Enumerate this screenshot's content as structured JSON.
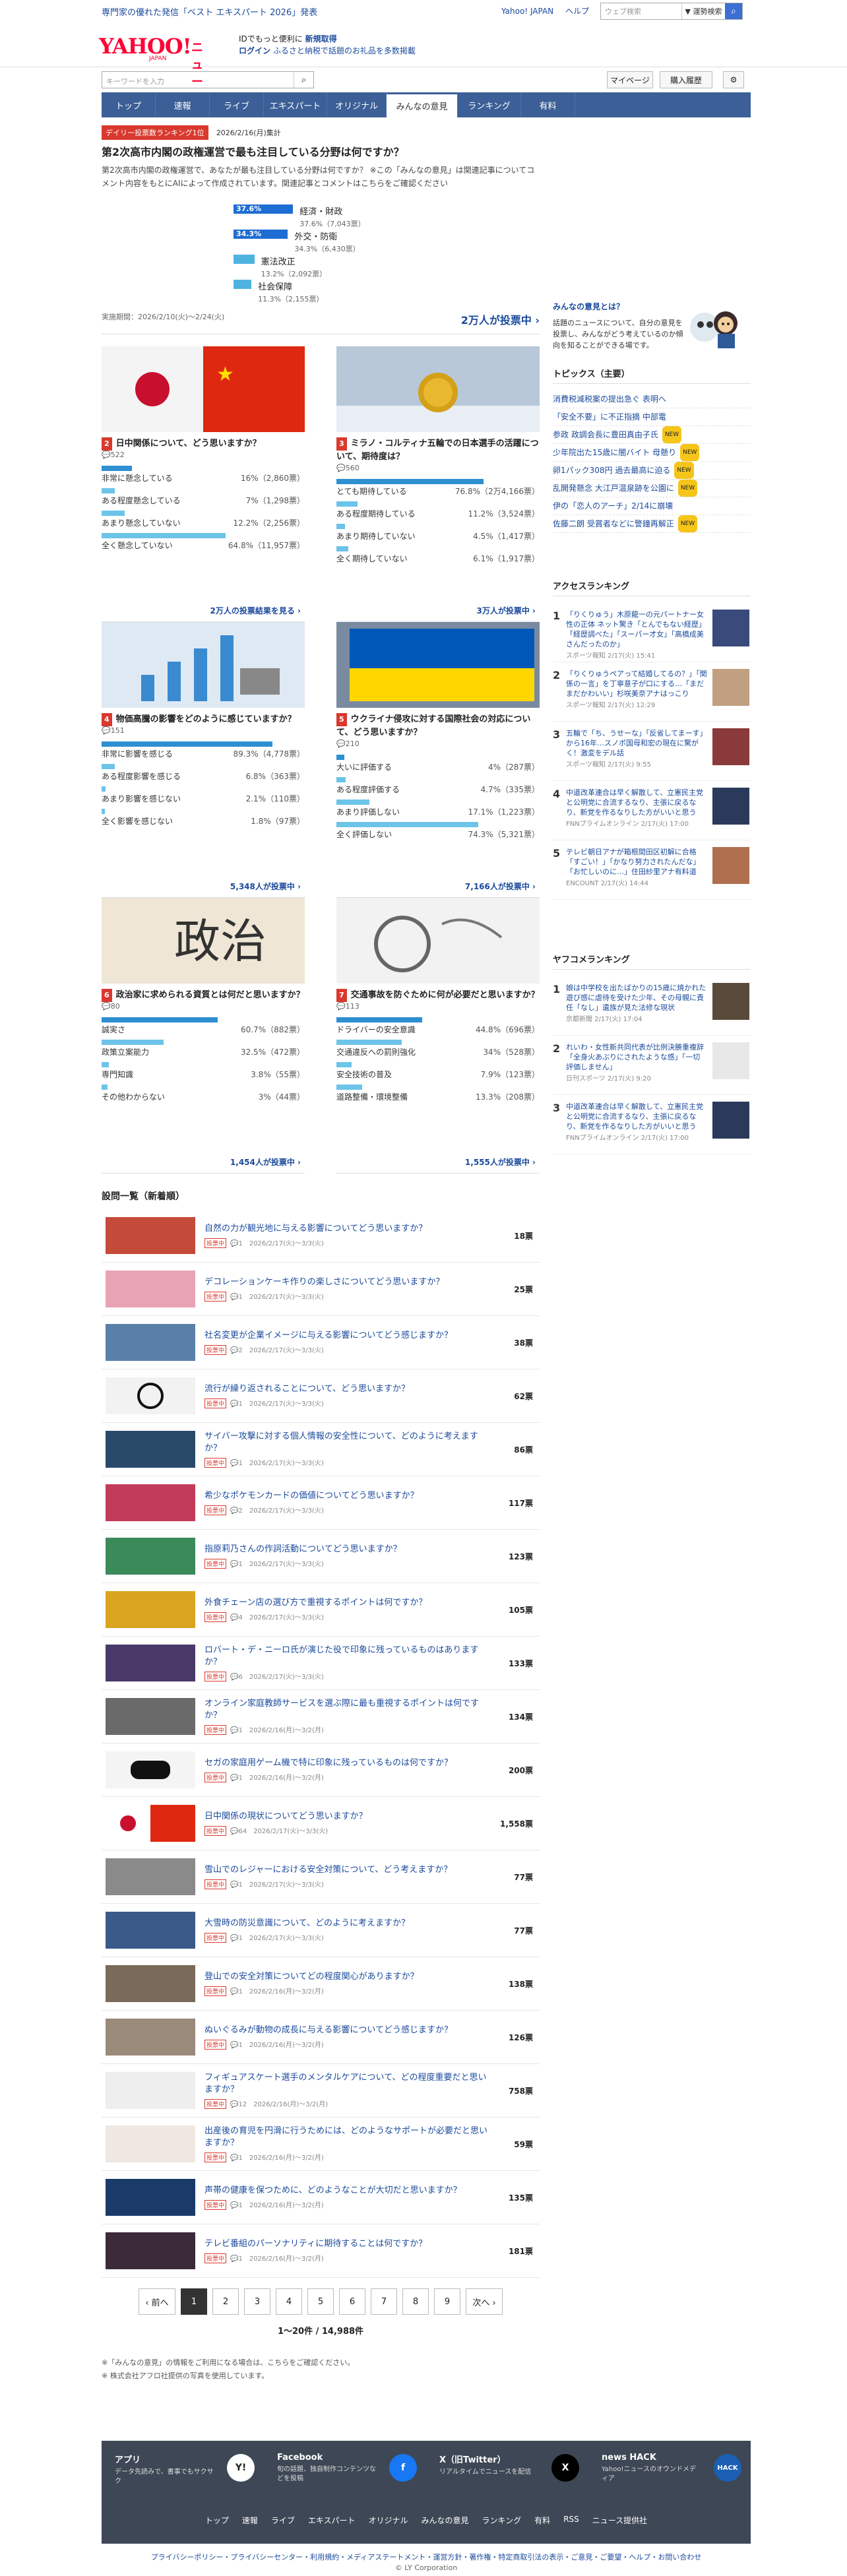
{
  "topbar": {
    "promo": "専門家の優れた発信「ベスト エキスパート 2026」発表",
    "links": [
      "Yahoo! JAPAN",
      "ヘルプ"
    ],
    "search_placeholder": "ウェブ検索",
    "search_option": "▼ 運勢検索"
  },
  "header": {
    "logo": "YAHOO!",
    "logo_sub": "JAPAN",
    "service": "ニュース",
    "msg1": "IDでもっと便利に",
    "msg1_link": "新規取得",
    "msg2_link": "ログイン",
    "msg2": "ふるさと納税で話題のお礼品を多数掲載"
  },
  "search2": {
    "placeholder": "キーワードを入力"
  },
  "rightbtns": [
    "マイページ",
    "購入履歴"
  ],
  "gnav": [
    "トップ",
    "速報",
    "ライブ",
    "エキスパート",
    "オリジナル",
    "みんなの意見",
    "ランキング",
    "有料"
  ],
  "hero": {
    "badge": "デイリー投票数ランキング1位",
    "date": "2026/2/16(月)集計",
    "title": "第2次高市内閣の政権運営で最も注目している分野は何ですか？",
    "desc": "第2次高市内閣の政権運営で、あなたが最も注目している分野は何ですか？ ※この「みんなの意見」は関連記事についてコメント内容をもとにAIによって作成されています。関連記事とコメントはこちらをご確認ください",
    "options": [
      {
        "label": "経済・財政",
        "pct": "37.6%",
        "sub": "37.6%（7,043票）",
        "v": 37.6
      },
      {
        "label": "外交・防衛",
        "pct": "34.3%",
        "sub": "34.3%（6,430票）",
        "v": 34.3
      },
      {
        "label": "憲法改正",
        "pct": "",
        "sub": "13.2%（2,092票）",
        "v": 13.2
      },
      {
        "label": "社会保障",
        "pct": "",
        "sub": "11.3%（2,155票）",
        "v": 11.3
      }
    ],
    "period": "実施期間：2026/2/10(火)〜2/24(火)",
    "total": "2万人が投票中 ›"
  },
  "cards": [
    {
      "no": "2",
      "q": "日中関係について、どう思いますか？",
      "meta": "💬522",
      "rows": [
        {
          "l": "非常に懸念している",
          "p": "16%（2,860票）",
          "v": 16
        },
        {
          "l": "ある程度懸念している",
          "p": "7%（1,298票）",
          "v": 7
        },
        {
          "l": "あまり懸念していない",
          "p": "12.2%（2,256票）",
          "v": 12.2
        },
        {
          "l": "全く懸念していない",
          "p": "64.8%（11,957票）",
          "v": 64.8
        }
      ],
      "tot": "2万人の投票結果を見る ›"
    },
    {
      "no": "3",
      "q": "ミラノ・コルティナ五輪での日本選手の活躍について、期待度は？",
      "meta": "💬560",
      "rows": [
        {
          "l": "とても期待している",
          "p": "76.8%（2万4,166票）",
          "v": 76.8
        },
        {
          "l": "ある程度期待している",
          "p": "11.2%（3,524票）",
          "v": 11.2
        },
        {
          "l": "あまり期待していない",
          "p": "4.5%（1,417票）",
          "v": 4.5
        },
        {
          "l": "全く期待していない",
          "p": "6.1%（1,917票）",
          "v": 6.1
        }
      ],
      "tot": "3万人が投票中 ›"
    },
    {
      "no": "4",
      "q": "物価高騰の影響をどのように感じていますか？",
      "meta": "💬151",
      "rows": [
        {
          "l": "非常に影響を感じる",
          "p": "89.3%（4,778票）",
          "v": 89.3
        },
        {
          "l": "ある程度影響を感じる",
          "p": "6.8%（363票）",
          "v": 6.8
        },
        {
          "l": "あまり影響を感じない",
          "p": "2.1%（110票）",
          "v": 2.1
        },
        {
          "l": "全く影響を感じない",
          "p": "1.8%（97票）",
          "v": 1.8
        }
      ],
      "tot": "5,348人が投票中 ›"
    },
    {
      "no": "5",
      "q": "ウクライナ侵攻に対する国際社会の対応について、どう思いますか？",
      "meta": "💬210",
      "rows": [
        {
          "l": "大いに評価する",
          "p": "4%（287票）",
          "v": 4
        },
        {
          "l": "ある程度評価する",
          "p": "4.7%（335票）",
          "v": 4.7
        },
        {
          "l": "あまり評価しない",
          "p": "17.1%（1,223票）",
          "v": 17.1
        },
        {
          "l": "全く評価しない",
          "p": "74.3%（5,321票）",
          "v": 74.3
        }
      ],
      "tot": "7,166人が投票中 ›"
    },
    {
      "no": "6",
      "q": "政治家に求められる資質とは何だと思いますか？",
      "meta": "💬80",
      "rows": [
        {
          "l": "誠実さ",
          "p": "60.7%（882票）",
          "v": 60.7
        },
        {
          "l": "政策立案能力",
          "p": "32.5%（472票）",
          "v": 32.5
        },
        {
          "l": "専門知識",
          "p": "3.8%（55票）",
          "v": 3.8
        },
        {
          "l": "その他わからない",
          "p": "3%（44票）",
          "v": 3
        }
      ],
      "tot": "1,454人が投票中 ›"
    },
    {
      "no": "7",
      "q": "交通事故を防ぐために何が必要だと思いますか？",
      "meta": "💬113",
      "rows": [
        {
          "l": "ドライバーの安全意識",
          "p": "44.8%（696票）",
          "v": 44.8
        },
        {
          "l": "交通違反への罰則強化",
          "p": "34%（528票）",
          "v": 34
        },
        {
          "l": "安全技術の普及",
          "p": "7.9%（123票）",
          "v": 7.9
        },
        {
          "l": "道路整備・環境整備",
          "p": "13.3%（208票）",
          "v": 13.3
        }
      ],
      "tot": "1,555人が投票中 ›"
    }
  ],
  "list_title": "設問一覧（新着順）",
  "list": [
    {
      "t": "自然の力が観光地に与える影響についてどう思いますか？",
      "m": "💬1　2026/2/17(火)〜3/3(火)",
      "v": "18票",
      "c": "#c44a3a"
    },
    {
      "t": "デコレーションケーキ作りの楽しさについてどう思いますか？",
      "m": "💬1　2026/2/17(火)〜3/3(火)",
      "v": "25票",
      "c": "#e8a3b5"
    },
    {
      "t": "社名変更が企業イメージに与える影響についてどう感じますか？",
      "m": "💬2　2026/2/17(火)〜3/3(火)",
      "v": "38票",
      "c": "#5a7fa8"
    },
    {
      "t": "流行が繰り返されることについて、どう思いますか？",
      "m": "💬1　2026/2/17(火)〜3/3(火)",
      "v": "62票",
      "c": "#f2f2f2"
    },
    {
      "t": "サイバー攻撃に対する個人情報の安全性について、どのように考えますか？",
      "m": "💬1　2026/2/17(火)〜3/3(火)",
      "v": "86票",
      "c": "#2a4a6a"
    },
    {
      "t": "希少なポケモンカードの価値についてどう思いますか？",
      "m": "💬2　2026/2/17(火)〜3/3(火)",
      "v": "117票",
      "c": "#c23b5a"
    },
    {
      "t": "指原莉乃さんの作詞活動についてどう思いますか？",
      "m": "💬1　2026/2/17(火)〜3/3(火)",
      "v": "123票",
      "c": "#3a8a5a"
    },
    {
      "t": "外食チェーン店の選び方で重視するポイントは何ですか？",
      "m": "💬4　2026/2/17(火)〜3/3(火)",
      "v": "105票",
      "c": "#d9a520"
    },
    {
      "t": "ロバート・デ・ニーロ氏が演じた役で印象に残っているものはありますか？",
      "m": "💬6　2026/2/17(火)〜3/3(火)",
      "v": "133票",
      "c": "#4a3a6a"
    },
    {
      "t": "オンライン家庭教師サービスを選ぶ際に最も重視するポイントは何ですか？",
      "m": "💬1　2026/2/16(月)〜3/2(月)",
      "v": "134票",
      "c": "#6a6a6a"
    },
    {
      "t": "セガの家庭用ゲーム機で特に印象に残っているものは何ですか？",
      "m": "💬1　2026/2/16(月)〜3/2(月)",
      "v": "200票",
      "c": "#f4f4f4"
    },
    {
      "t": "日中関係の現状についてどう思いますか？",
      "m": "💬64　2026/2/17(火)〜3/3(火)",
      "v": "1,558票",
      "c": "#fafafa"
    },
    {
      "t": "雪山でのレジャーにおける安全対策について、どう考えますか？",
      "m": "💬1　2026/2/17(火)〜3/3(火)",
      "v": "77票",
      "c": "#8a8a8a"
    },
    {
      "t": "大雪時の防災意識について、どのように考えますか？",
      "m": "💬1　2026/2/17(火)〜3/3(火)",
      "v": "77票",
      "c": "#3a5a8a"
    },
    {
      "t": "登山での安全対策についてどの程度関心がありますか？",
      "m": "💬1　2026/2/16(月)〜3/2(月)",
      "v": "138票",
      "c": "#7a6a5a"
    },
    {
      "t": "ぬいぐるみが動物の成長に与える影響についてどう感じますか？",
      "m": "💬1　2026/2/16(月)〜3/2(月)",
      "v": "126票",
      "c": "#9a8a7a"
    },
    {
      "t": "フィギュアスケート選手のメンタルケアについて、どの程度重要だと思いますか？",
      "m": "💬12　2026/2/16(月)〜3/2(月)",
      "v": "758票",
      "c": "#eeeeee"
    },
    {
      "t": "出産後の育児を円滑に行うためには、どのようなサポートが必要だと思いますか？",
      "m": "💬1　2026/2/16(月)〜3/2(月)",
      "v": "59票",
      "c": "#f0e8e0"
    },
    {
      "t": "声帯の健康を保つために、どのようなことが大切だと思いますか？",
      "m": "💬1　2026/2/16(月)〜3/2(月)",
      "v": "135票",
      "c": "#1a3a6a"
    },
    {
      "t": "テレビ番組のパーソナリティに期待することは何ですか？",
      "m": "💬1　2026/2/16(月)〜3/2(月)",
      "v": "181票",
      "c": "#3a2a3a"
    }
  ],
  "list_tag": "投票中",
  "pager": {
    "prev": "‹ 前へ",
    "pages": [
      "1",
      "2",
      "3",
      "4",
      "5",
      "6",
      "7",
      "8",
      "9"
    ],
    "next": "次へ ›"
  },
  "count": "1〜20件 / 14,988件",
  "notes": [
    "※「みんなの意見」の情報をご利用になる場合は、こちらをご確認ください。",
    "※ 株式会社アフロ社提供の写真を使用しています。"
  ],
  "side": {
    "about_title": "みんなの意見とは？",
    "about_desc": "話題のニュースについて、自分の意見を投票し、みんながどう考えているのか傾向を知ることができる場です。",
    "topics_title": "トピックス（主要）",
    "topics": [
      {
        "t": "消費税減税案の提出急ぐ 表明へ",
        "n": ""
      },
      {
        "t": "「安全不要」に不正指摘 中部電",
        "n": ""
      },
      {
        "t": "参政 政調会長に豊田真由子氏",
        "n": "NEW"
      },
      {
        "t": "少年院出た15歳に闇バイト 母懸り",
        "n": "NEW"
      },
      {
        "t": "卵1パック308円 過去最高に迫る",
        "n": "NEW"
      },
      {
        "t": "乱開発懸念 大江戸温泉跡を公園に",
        "n": "NEW"
      },
      {
        "t": "伊の「恋人のアーチ」2/14に崩壊",
        "n": ""
      },
      {
        "t": "佐藤二朗 受賞者などに警鐘再解正",
        "n": "NEW"
      }
    ],
    "access_title": "アクセスランキング",
    "access": [
      {
        "t": "「りくりゅう」木原龍一の元パートナー女性の正体 ネット驚き「とんでもない経歴」「経歴調べた」「スーパー才女」「高橋成美さんだったのか」",
        "s": "スポーツ報知 2/17(火) 15:41"
      },
      {
        "t": "「りくりゅうペアって結婚してるの？」「関係の一言」を丁寧意子が口にする…「まだまだかわいい」杉咲美奈アナはっこり",
        "s": "スポーツ報知 2/17(火) 12:29"
      },
      {
        "t": "五輪で「ち、うせーな」「反省してまーす」から16年…スノボ国母和宏の現在に驚がく！激変をデル話",
        "s": "スポーツ報知 2/17(火) 9:55"
      },
      {
        "t": "中道改革連合は早く解散して、立憲民主党と公明党に合流するなり、主張に戻るなり、新党を作るなりした方がいいと思う",
        "s": "FNNプライムオンライン 2/17(火) 17:00"
      },
      {
        "t": "テレビ朝日アナが箱根間田区初解に合格「すごい！」「かなり努力されたんだな」「お忙しいのに…」住田紗里アナ有料道",
        "s": "ENCOUNT 2/17(火) 14:44"
      }
    ],
    "yahoo_title": "ヤフコメランキング",
    "yahoo": [
      {
        "t": "娘は中学校を出たばかりの15歳に焼かれた 遊び感に虐待を受けた少年、その母親に責任「なし」遺族が見た法修な現状",
        "s": "京都新聞 2/17(火) 17:04"
      },
      {
        "t": "れいわ・女性新共同代表が比例決勝重複辞「全身火あぶりにされたような感」「一切評価しません」",
        "s": "日刊スポーツ 2/17(火) 9:20"
      },
      {
        "t": "中道改革連合は早く解散して、立憲民主党と公明党に合流するなり、主張に戻るなり、新党を作るなりした方がいいと思う",
        "s": "FNNプライムオンライン 2/17(火) 17:00"
      }
    ]
  },
  "footer": {
    "blocks": [
      {
        "h": "アプリ",
        "d": "データ先読みで、書事でもサクサク",
        "icon": "Y!"
      },
      {
        "h": "Facebook",
        "d": "旬の話題、独自制作コンテンツなどを投稿",
        "icon": "f"
      },
      {
        "h": "X（旧Twitter）",
        "d": "リアルタイムでニュースを配信",
        "icon": "X"
      },
      {
        "h": "news HACK",
        "d": "Yahoo!ニュースのオウンドメディア",
        "icon": "HACK"
      }
    ],
    "nav": [
      "トップ",
      "速報",
      "ライブ",
      "エキスパート",
      "オリジナル",
      "みんなの意見",
      "ランキング",
      "有料",
      "RSS",
      "ニュース提供社"
    ],
    "legal": "プライバシーポリシー・プライバシーセンター・利用規約・メディアステートメント・運営方針・著作権・特定商取引法の表示・ご意見・ご要望・ヘルプ・お問い合わせ",
    "copy": "© LY Corporation"
  },
  "colors": {
    "brand": "#ff0033",
    "nav": "#3b5f96",
    "bar": "#2e8fd1",
    "badge": "#d9392e"
  }
}
